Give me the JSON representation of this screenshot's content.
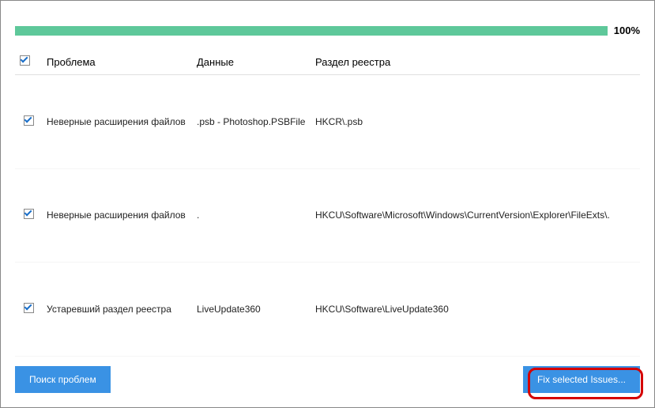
{
  "progress": {
    "percent_label": "100%"
  },
  "columns": {
    "problem": "Проблема",
    "data": "Данные",
    "registry": "Раздел реестра"
  },
  "rows": [
    {
      "checked": true,
      "problem": "Неверные расширения файлов",
      "data": ".psb - Photoshop.PSBFile",
      "registry": "HKCR\\.psb"
    },
    {
      "checked": true,
      "problem": "Неверные расширения файлов",
      "data": ".",
      "registry": "HKCU\\Software\\Microsoft\\Windows\\CurrentVersion\\Explorer\\FileExts\\."
    },
    {
      "checked": true,
      "problem": "Устаревший раздел реестра",
      "data": "LiveUpdate360",
      "registry": "HKCU\\Software\\LiveUpdate360"
    }
  ],
  "buttons": {
    "search": "Поиск проблем",
    "fix": "Fix selected Issues..."
  }
}
